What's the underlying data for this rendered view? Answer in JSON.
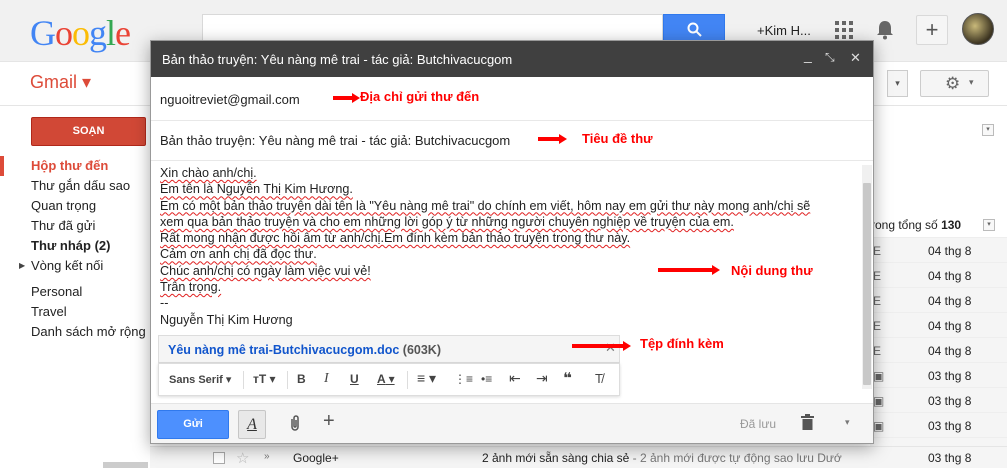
{
  "header": {
    "logo_letters": [
      "G",
      "o",
      "o",
      "g",
      "l",
      "e"
    ],
    "logo_colors": [
      "#4285f4",
      "#ea4335",
      "#fbbc05",
      "#4285f4",
      "#34a853",
      "#ea4335"
    ],
    "user_name": "+Kim H...",
    "apps_icon": "apps-grid-icon",
    "bell_icon": "notifications-bell-icon",
    "plus_label": "+"
  },
  "subheader": {
    "gmail_label": "Gmail ▾",
    "more_chevron": "▾",
    "gear_glyph": "⚙",
    "gear_chevron": "▾"
  },
  "sidebar": {
    "compose_label": "SOẠN",
    "items": [
      {
        "label": "Hộp thư đến",
        "style": "active"
      },
      {
        "label": "Thư gắn dấu sao",
        "style": ""
      },
      {
        "label": "Quan trọng",
        "style": ""
      },
      {
        "label": "Thư đã gửi",
        "style": ""
      },
      {
        "label": "Thư nháp (2)",
        "style": "bold"
      },
      {
        "label": "Vòng kết nối",
        "style": "tree"
      },
      {
        "label": "Personal",
        "style": ""
      },
      {
        "label": "Travel",
        "style": ""
      },
      {
        "label": "Danh sách mở rộng",
        "style": ""
      }
    ]
  },
  "mail_list": {
    "total_prefix": "rong tổng số",
    "total_count": "130",
    "rows": [
      {
        "mark": "E",
        "date": "04 thg 8"
      },
      {
        "mark": "E",
        "date": "04 thg 8"
      },
      {
        "mark": "E",
        "date": "04 thg 8"
      },
      {
        "mark": "E",
        "date": "04 thg 8"
      },
      {
        "mark": "E",
        "date": "04 thg 8"
      },
      {
        "mark": "▣",
        "date": "03 thg 8"
      },
      {
        "mark": "▣",
        "date": "03 thg 8"
      },
      {
        "mark": "▣",
        "date": "03 thg 8"
      },
      {
        "mark": "▣",
        "date": "03 thg 8"
      }
    ],
    "bottom_row": {
      "sender": "Google+",
      "subject": "2 ảnh mới sẵn sàng chia sẻ",
      "snippet": " - 2 ảnh mới được tự động sao lưu Dướ",
      "date": "03 thg 8"
    }
  },
  "compose": {
    "title": "Bản thảo truyện: Yêu nàng mê trai - tác giả: Butchivacucgom",
    "to": "nguoitreviet@gmail.com",
    "subject": "Bản thảo truyện: Yêu nàng mê trai - tác giả: Butchivacucgom",
    "body_lines": [
      "Xin chào anh/chị.",
      "Em tên là Nguyễn Thị Kim Hương.",
      "Em có một bản thảo truyện dài tên là \"Yêu nàng mê trai\" do chính em viết, hôm nay em gửi thư này mong anh/chị sẽ",
      "xem qua bản thảo truyện và cho em những lời góp ý từ những người chuyên nghiệp về truyện của em.",
      "Rất mong nhận được hồi âm từ anh/chị.Em đính kèm bản thảo truyện trong thư này.",
      "Cảm ơn anh chị đã đọc thư.",
      "Chúc anh/chị có ngày làm việc vui vẻ!",
      "Trân trọng.",
      "--",
      "Nguyễn Thị Kim Hương"
    ],
    "attachment": {
      "name": "Yêu nàng mê trai-Butchivacucgom.doc",
      "size": "(603K)"
    },
    "format_bar": {
      "font": "Sans Serif",
      "size_glyph": "тT",
      "bold": "B",
      "italic": "I",
      "underline": "U",
      "color": "A",
      "align": "≡",
      "numbered": "⋮≡",
      "bullets": "•≡",
      "indent_less": "⇤",
      "indent_more": "⇥",
      "quote": "❝",
      "clear": "T̸"
    },
    "send_label": "Gửi",
    "format_toggle": "A",
    "saved_label": "Đã lưu"
  },
  "annotations": {
    "to_label": "Địa chỉ gửi thư đến",
    "subject_label": "Tiêu đề thư",
    "body_label": "Nội dung thư",
    "attachment_label": "Tệp đính kèm"
  }
}
